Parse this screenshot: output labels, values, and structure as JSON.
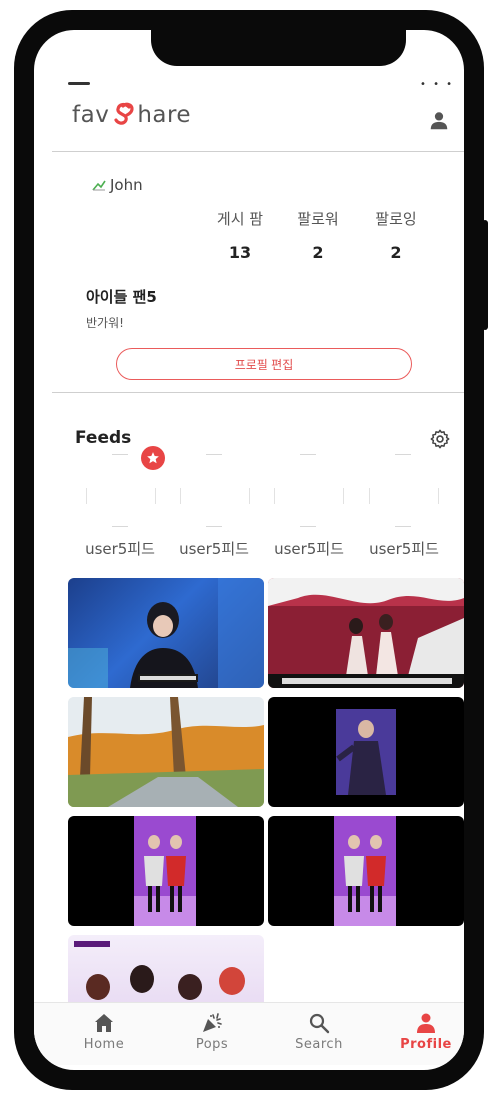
{
  "app": {
    "logo_left": "fav",
    "logo_right": "hare"
  },
  "profile": {
    "username": "John",
    "display_name": "아이들 팬5",
    "bio": "반가워!",
    "edit_button": "프로필 편집"
  },
  "stats": [
    {
      "label": "게시 팜",
      "value": "13"
    },
    {
      "label": "팔로워",
      "value": "2"
    },
    {
      "label": "팔로잉",
      "value": "2"
    }
  ],
  "feeds": {
    "title": "Feeds",
    "stories": [
      {
        "label": "user5피드"
      },
      {
        "label": "user5피드"
      },
      {
        "label": "user5피드"
      },
      {
        "label": "user5피드"
      }
    ]
  },
  "tabs": [
    {
      "label": "Home",
      "icon": "home-icon"
    },
    {
      "label": "Pops",
      "icon": "party-popper-icon"
    },
    {
      "label": "Search",
      "icon": "search-icon"
    },
    {
      "label": "Profile",
      "icon": "person-icon"
    }
  ],
  "colors": {
    "accent": "#e84545",
    "text": "#222222",
    "muted": "#7a7a7a"
  }
}
